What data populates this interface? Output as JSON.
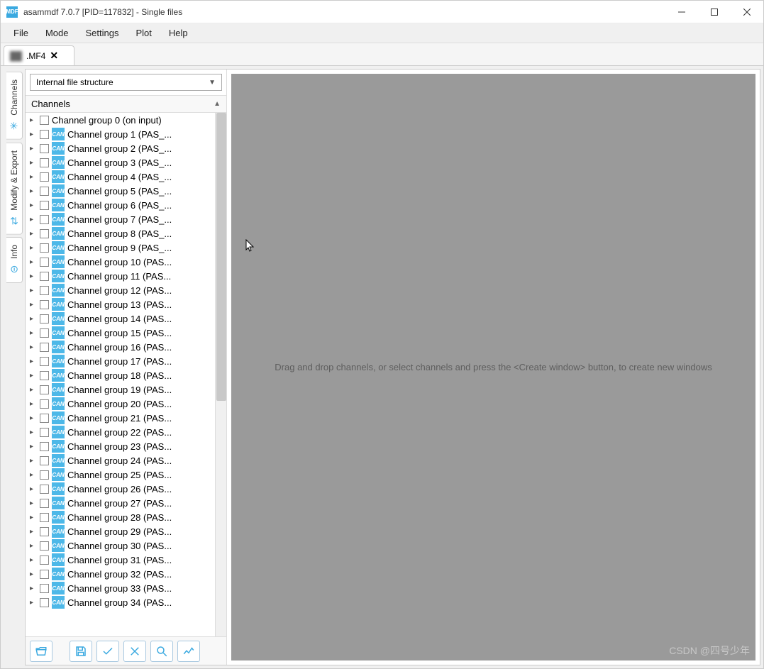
{
  "window": {
    "app_icon_text": "MDF",
    "title": "asammdf 7.0.7 [PID=117832] - Single files"
  },
  "menu": {
    "items": [
      "File",
      "Mode",
      "Settings",
      "Plot",
      "Help"
    ]
  },
  "tabs": {
    "file_tab_label": ".MF4",
    "close_glyph": "✕"
  },
  "side_tabs": {
    "channels": "Channels",
    "modify": "Modify & Export",
    "info": "Info"
  },
  "dropdown": {
    "selected": "Internal file structure"
  },
  "channels_header": "Channels",
  "tree": {
    "first_row": "Channel group 0 (on input)",
    "rows": [
      "Channel group 1 (PAS_...",
      "Channel group 2 (PAS_...",
      "Channel group 3 (PAS_...",
      "Channel group 4 (PAS_...",
      "Channel group 5 (PAS_...",
      "Channel group 6 (PAS_...",
      "Channel group 7 (PAS_...",
      "Channel group 8 (PAS_...",
      "Channel group 9 (PAS_...",
      "Channel group 10 (PAS...",
      "Channel group 11 (PAS...",
      "Channel group 12 (PAS...",
      "Channel group 13 (PAS...",
      "Channel group 14 (PAS...",
      "Channel group 15 (PAS...",
      "Channel group 16 (PAS...",
      "Channel group 17 (PAS...",
      "Channel group 18 (PAS...",
      "Channel group 19 (PAS...",
      "Channel group 20 (PAS...",
      "Channel group 21 (PAS...",
      "Channel group 22 (PAS...",
      "Channel group 23 (PAS...",
      "Channel group 24 (PAS...",
      "Channel group 25 (PAS...",
      "Channel group 26 (PAS...",
      "Channel group 27 (PAS...",
      "Channel group 28 (PAS...",
      "Channel group 29 (PAS...",
      "Channel group 30 (PAS...",
      "Channel group 31 (PAS...",
      "Channel group 32 (PAS...",
      "Channel group 33 (PAS...",
      "Channel group 34 (PAS..."
    ],
    "can_text": "CAN"
  },
  "toolbar_icons": [
    "folder-open",
    "save",
    "check",
    "delete",
    "search",
    "graph"
  ],
  "drop_area": {
    "text": "Drag and drop channels, or select channels and press the <Create window> button, to create new windows"
  },
  "watermark": "CSDN @四号少年"
}
